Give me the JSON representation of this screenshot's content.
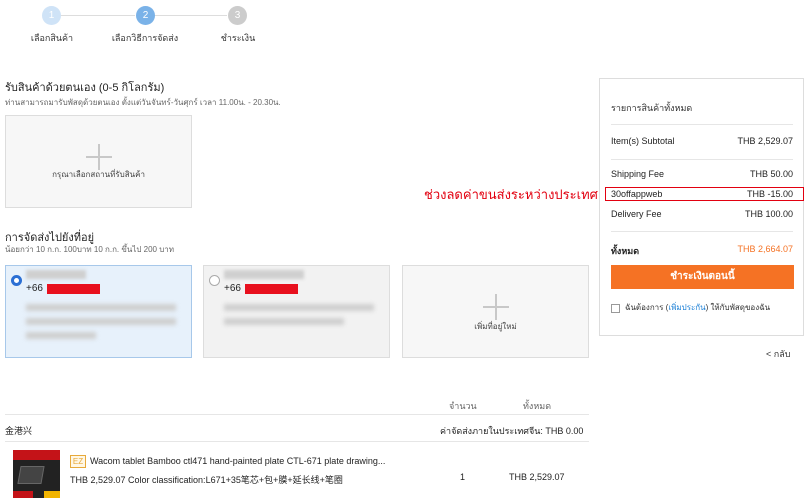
{
  "steps": [
    {
      "num": "1",
      "label": "เลือกสินค้า"
    },
    {
      "num": "2",
      "label": "เลือกวิธีการจัดส่ง"
    },
    {
      "num": "3",
      "label": "ชำระเงิน"
    }
  ],
  "pickup": {
    "title": "รับสินค้าด้วยตนเอง (0-5 กิโลกรัม)",
    "subtitle": "ท่านสามารถมารับพัสดุด้วยตนเอง ตั้งแต่วันจันทร์-วันศุกร์ เวลา 11.00น. - 20.30น.",
    "select_label": "กรุณาเลือกสถานที่รับสินค้า"
  },
  "delivery": {
    "title": "การจัดส่งไปยังที่อยู่",
    "subtitle": "น้อยกว่า 10 ก.ก. 100บาท 10 ก.ก. ขึ้นไป 200 บาท",
    "addresses": [
      {
        "phone": "+66",
        "selected": true
      },
      {
        "phone": "+66",
        "selected": false
      }
    ],
    "add_label": "เพิ่มที่อยู่ใหม่"
  },
  "annotation": "ช่วงลดค่าขนส่งระหว่างประเทศ",
  "table": {
    "col_qty": "จำนวน",
    "col_total": "ทั้งหมด",
    "seller": "金港兴",
    "domestic_shipping": "ค่าจัดส่งภายในประเทศจีน: THB 0.00",
    "item": {
      "badge": "EZ",
      "name": "Wacom tablet Bamboo ctl471 hand-painted plate CTL-671 plate drawing...",
      "price_desc": "THB 2,529.07 Color classification:L671+35笔芯+包+膜+延长线+笔圈",
      "qty": "1",
      "total": "THB 2,529.07"
    }
  },
  "summary": {
    "header": "รายการสินค้าทั้งหมด",
    "rows": [
      {
        "label": "Item(s) Subtotal",
        "value": "THB 2,529.07"
      },
      {
        "label": "Shipping Fee",
        "value": "THB 50.00"
      },
      {
        "label": "30offappweb",
        "value": "THB -15.00"
      },
      {
        "label": "Delivery Fee",
        "value": "THB 100.00"
      }
    ],
    "total_label": "ทั้งหมด",
    "total_value": "THB 2,664.07",
    "pay_button": "ชำระเงินตอนนี้",
    "insure_pre": "ฉันต้องการ (",
    "insure_link": "เพิ่มประกัน",
    "insure_post": ") ให้กับพัสดุของฉัน",
    "accent": "#f57224"
  },
  "back_link": "< กลับ"
}
